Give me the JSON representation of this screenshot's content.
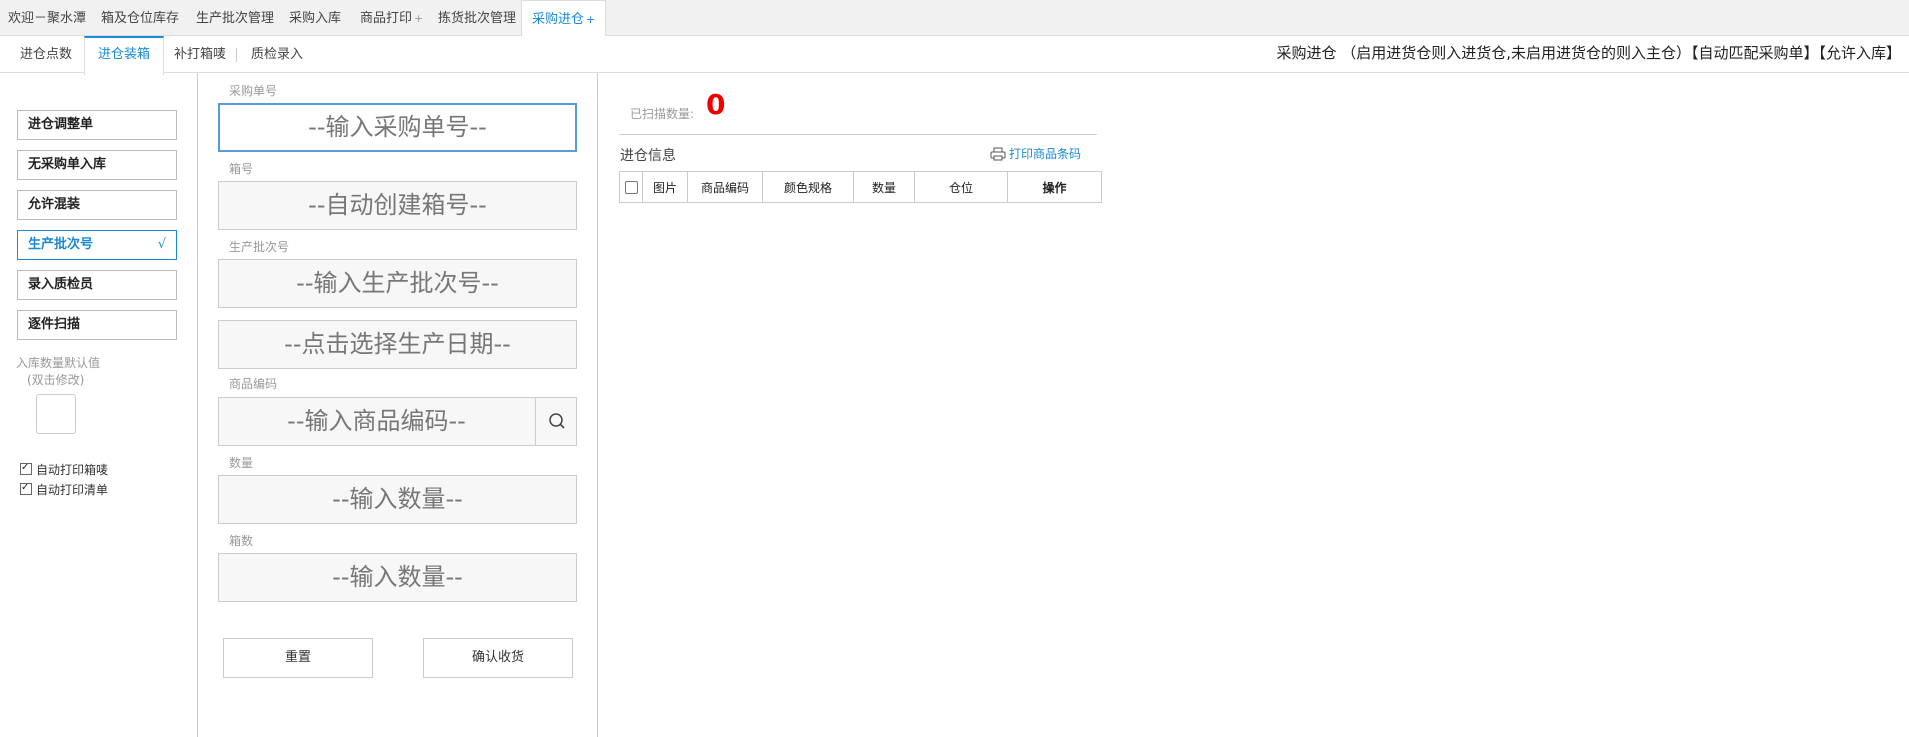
{
  "top_tabs": [
    {
      "label": "欢迎－聚水潭",
      "plus": ""
    },
    {
      "label": "箱及仓位库存",
      "plus": ""
    },
    {
      "label": "生产批次管理",
      "plus": ""
    },
    {
      "label": "采购入库",
      "plus": ""
    },
    {
      "label": "商品打印",
      "plus": "+"
    },
    {
      "label": "拣货批次管理",
      "plus": ""
    },
    {
      "label": "采购进仓",
      "plus": "+"
    }
  ],
  "sub_tabs": [
    {
      "label": "进仓点数"
    },
    {
      "label": "进仓装箱"
    },
    {
      "label": "补打箱唛"
    },
    {
      "label": "质检录入"
    }
  ],
  "mode_text": "采购进仓 （启用进货仓则入进货仓,未启用进货仓的则入主仓）【自动匹配采购单】【允许入库】",
  "options": [
    {
      "label": "进仓调整单",
      "mark": ""
    },
    {
      "label": "无采购单入库",
      "mark": ""
    },
    {
      "label": "允许混装",
      "mark": ""
    },
    {
      "label": "生产批次号",
      "mark": "√"
    },
    {
      "label": "录入质检员",
      "mark": ""
    },
    {
      "label": "逐件扫描",
      "mark": ""
    }
  ],
  "default_qty": {
    "label": "入库数量默认值",
    "hint": "(双击修改)",
    "value": ""
  },
  "checkboxes": [
    {
      "label": "自动打印箱唛",
      "checked": true
    },
    {
      "label": "自动打印清单",
      "checked": true
    }
  ],
  "form": {
    "po_label": "采购单号",
    "po_placeholder": "--输入采购单号--",
    "box_label": "箱号",
    "box_placeholder": "--自动创建箱号--",
    "batch_label": "生产批次号",
    "batch_placeholder": "--输入生产批次号--",
    "date_placeholder": "--点击选择生产日期--",
    "sku_label": "商品编码",
    "sku_placeholder": "--输入商品编码--",
    "qty_label": "数量",
    "qty_placeholder": "--输入数量--",
    "boxes_label": "箱数",
    "boxes_placeholder": "--输入数量--",
    "reset_label": "重置",
    "confirm_label": "确认收货"
  },
  "scan": {
    "label": "已扫描数量:",
    "count": "0"
  },
  "info": {
    "title": "进仓信息",
    "print_link": "打印商品条码",
    "columns": [
      "图片",
      "商品编码",
      "颜色规格",
      "数量",
      "仓位",
      "操作"
    ]
  },
  "colors": {
    "accent": "#1a8ad6",
    "count": "#ee0000"
  }
}
